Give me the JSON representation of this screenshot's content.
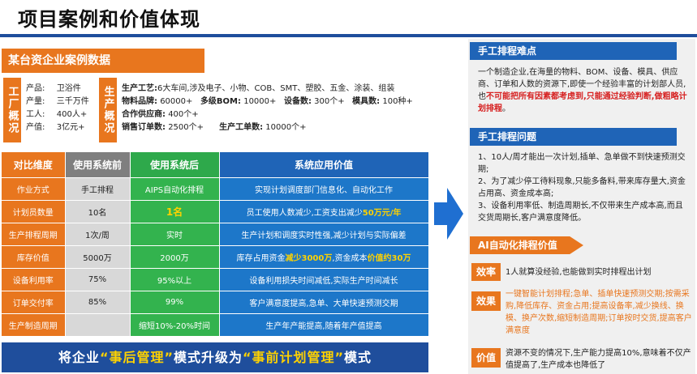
{
  "page_title": "项目案例和价值体现",
  "case_title": "某台资企业案例数据",
  "factory_overview": {
    "tag": "工厂概况",
    "rows": [
      {
        "label": "产品:",
        "value": "卫浴件"
      },
      {
        "label": "产量:",
        "value": "三千万件"
      },
      {
        "label": "工人:",
        "value": "400人+"
      },
      {
        "label": "产值:",
        "value": "3亿元+"
      }
    ]
  },
  "production_overview": {
    "tag": "生产概况",
    "process_label": "生产工艺:",
    "process_value": "6大车间,涉及电子、小物、COB、SMT、塑胶、五金、涂装、组装",
    "brand_label": "物料品牌:",
    "brand_value": "60000+",
    "bom_label": "多级BOM:",
    "bom_value": "10000+",
    "device_label": "设备数:",
    "device_value": "300个+",
    "mold_label": "模具数:",
    "mold_value": "100种+",
    "supplier_label": "合作供应商:",
    "supplier_value": "400个+",
    "sales_label": "销售订单数:",
    "sales_value": "2500个+",
    "prod_order_label": "生产工单数:",
    "prod_order_value": "10000个+"
  },
  "table": {
    "headers": [
      "对比维度",
      "使用系统前",
      "使用系统后",
      "系统应用价值"
    ],
    "rows": [
      {
        "dim": "作业方式",
        "before": "手工排程",
        "after": "AIPS自动化排程",
        "value_a": "实现计划调度部门信息化、自动化工作",
        "value_hl": "",
        "value_b": "",
        "value_hl2": ""
      },
      {
        "dim": "计划员数量",
        "before": "10名",
        "after": "1名",
        "value_a": "员工使用人数减少,工资支出减少",
        "value_hl": "50万元/年",
        "value_b": "",
        "value_hl2": ""
      },
      {
        "dim": "生产排程周期",
        "before": "1次/周",
        "after": "实时",
        "value_a": "生产计划和调度实时性强,减少计划与实际偏差",
        "value_hl": "",
        "value_b": "",
        "value_hl2": ""
      },
      {
        "dim": "库存价值",
        "before": "5000万",
        "after": "2000万",
        "value_a": "库存占用资金",
        "value_hl": "减少3000万",
        "value_b": ",资金成本",
        "value_hl2": "价值约30万"
      },
      {
        "dim": "设备利用率",
        "before": "75%",
        "after": "95%以上",
        "value_a": "设备利用损失时间减低,实际生产时间减长",
        "value_hl": "",
        "value_b": "",
        "value_hl2": ""
      },
      {
        "dim": "订单交付率",
        "before": "85%",
        "after": "99%",
        "value_a": "客户满意度提高,急单、大单快速预测交期",
        "value_hl": "",
        "value_b": "",
        "value_hl2": ""
      },
      {
        "dim": "生产制造周期",
        "before": "",
        "after": "缩短10%-20%时间",
        "value_a": "生产年产能提高,随着年产值提高",
        "value_hl": "",
        "value_b": "",
        "value_hl2": ""
      }
    ]
  },
  "banner": {
    "pre": "将企业",
    "q1": "“事后管理”",
    "mid": "模式升级为",
    "q2": "“事前计划管理”",
    "post": "模式"
  },
  "right": {
    "difficulty_title": "手工排程难点",
    "difficulty_text_a": "一个制造企业,在海量的物料、BOM、设备、模具、供应商、订单和人数的资源下,即使一个经验丰富的计划部人员,也",
    "difficulty_text_warn": "不可能把所有因素都考虑到,只能通过经验判断,做粗略计划排程",
    "difficulty_text_b": "。",
    "problem_title": "手工排程问题",
    "problems": [
      "1、10人/周才能出一次计划,插单、急单做不到快速预测交期;",
      "2、为了减少停工待料现象,只能多备料,带来库存量大,资金占用高、资金成本高;",
      "3、设备利用率低、制造周期长,不仅带来生产成本高,而且交货周期长,客户满意度降低。"
    ],
    "ai_title": "AI自动化排程价值",
    "values": [
      {
        "tag": "效率",
        "text": "1人就算没经验,也能做到实时排程出计划"
      },
      {
        "tag": "效果",
        "text": "一键智能计划排程;急单、插单快速预测交期;按需采购,降低库存、资金占用;提高设备率,减少换线、换模、换产次数,缩短制造周期;订单按时交货,提高客户满意度"
      },
      {
        "tag": "价值",
        "text": "资源不变的情况下,生产能力提高10%,意味着不仅产值提高了,生产成本也降低了"
      }
    ]
  }
}
